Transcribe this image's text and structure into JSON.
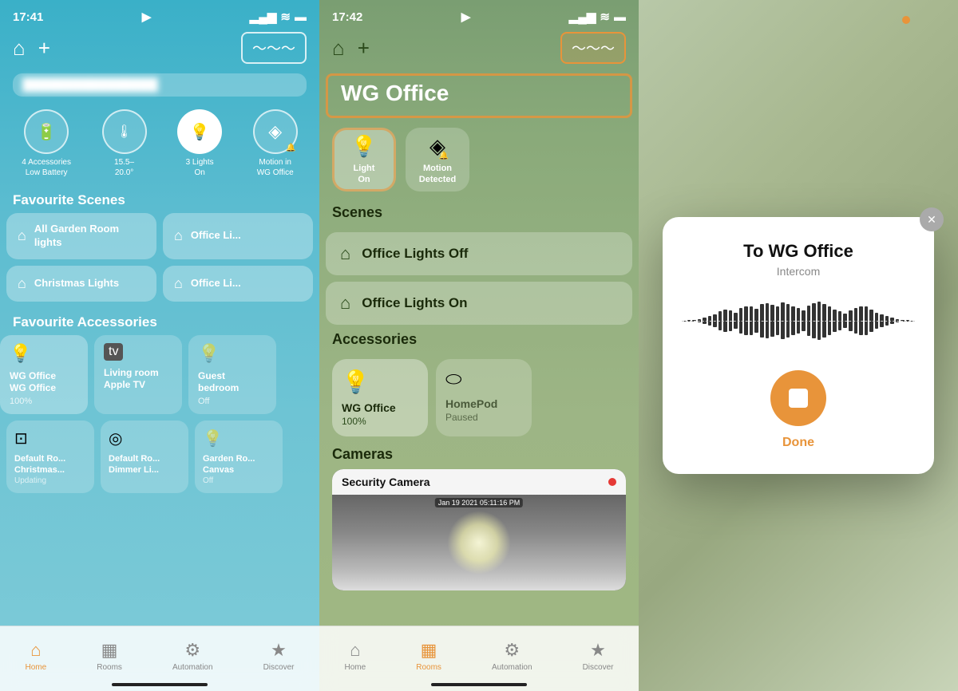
{
  "panel1": {
    "statusBar": {
      "time": "17:41",
      "locationIcon": "▶",
      "signal": "▂▄",
      "wifi": "📶",
      "battery": "🔋"
    },
    "nav": {
      "homeIcon": "⌂",
      "addIcon": "+",
      "soundwaveLabel": "〜〜〜"
    },
    "homeName": "Blurred Home Name",
    "accessories": [
      {
        "icon": "🔋",
        "label": "4 Accessories\nLow Battery",
        "active": false
      },
      {
        "icon": "🌡",
        "label": "15.5–\n20.0°",
        "active": false
      },
      {
        "icon": "💡",
        "label": "3 Lights\nOn",
        "active": true
      },
      {
        "icon": "◈",
        "label": "Motion in\nWG Office",
        "active": false
      }
    ],
    "favouriteScenes": {
      "heading": "Favourite Scenes",
      "items": [
        {
          "icon": "⌂",
          "label": "All Garden Room lights"
        },
        {
          "icon": "⌂",
          "label": "Office Li..."
        },
        {
          "icon": "⌂",
          "label": "Christmas Lights"
        },
        {
          "icon": "⌂",
          "label": "Office Li..."
        }
      ]
    },
    "favouriteAccessories": {
      "heading": "Favourite Accessories",
      "row1": [
        {
          "icon": "💡",
          "name": "WG Office\nWG Office",
          "status": "100%",
          "active": true
        },
        {
          "icon": "📺",
          "name": "Living room\nApple TV",
          "status": "",
          "active": false
        },
        {
          "icon": "💡",
          "name": "Guest\nbedroom",
          "status": "Off",
          "active": false
        }
      ],
      "row2": [
        {
          "icon": "⊡",
          "name": "Default Ro...\nChristmas...",
          "status": "Updating",
          "active": false
        },
        {
          "icon": "◎",
          "name": "Default Ro...\nDimmer Li...",
          "status": "",
          "active": false
        },
        {
          "icon": "💡",
          "name": "Garden Ro...\nCanvas",
          "status": "Off",
          "active": false
        }
      ]
    },
    "tabBar": {
      "tabs": [
        {
          "icon": "⌂",
          "label": "Home",
          "active": true
        },
        {
          "icon": "▦",
          "label": "Rooms",
          "active": false
        },
        {
          "icon": "⚙",
          "label": "Automation",
          "active": false
        },
        {
          "icon": "★",
          "label": "Discover",
          "active": false
        }
      ]
    }
  },
  "panel2": {
    "statusBar": {
      "time": "17:42",
      "locationIcon": "▶"
    },
    "nav": {
      "homeIcon": "⌂",
      "addIcon": "+",
      "soundwaveLabel": "〜〜〜"
    },
    "title": "WG Office",
    "accessories": [
      {
        "icon": "💡",
        "labelLine1": "Light",
        "labelLine2": "On"
      },
      {
        "icon": "◈",
        "labelLine1": "Motion",
        "labelLine2": "Detected"
      }
    ],
    "scenes": {
      "heading": "Scenes",
      "items": [
        {
          "icon": "⌂",
          "label": "Office Lights Off"
        },
        {
          "icon": "⌂",
          "label": "Office Lights On"
        }
      ]
    },
    "accessoriesSection": {
      "heading": "Accessories",
      "items": [
        {
          "icon": "💡",
          "name": "WG Office",
          "status": "100%",
          "muted": false
        },
        {
          "icon": "🔊",
          "name": "HomePod",
          "status": "Paused",
          "muted": true
        }
      ]
    },
    "cameras": {
      "heading": "Cameras",
      "cameraName": "Security Camera",
      "timestamp": "Jan 19 2021  05:11:16 PM"
    },
    "tabBar": {
      "tabs": [
        {
          "icon": "⌂",
          "label": "Home",
          "active": false
        },
        {
          "icon": "▦",
          "label": "Rooms",
          "active": true
        },
        {
          "icon": "⚙",
          "label": "Automation",
          "active": false
        },
        {
          "icon": "★",
          "label": "Discover",
          "active": false
        }
      ]
    }
  },
  "panel3": {
    "modal": {
      "title": "To WG Office",
      "subtitle": "Intercom",
      "stopButtonLabel": "Done",
      "closeIcon": "✕"
    },
    "waveformBars": [
      1,
      2,
      3,
      5,
      8,
      12,
      18,
      25,
      30,
      28,
      22,
      35,
      40,
      38,
      32,
      45,
      48,
      44,
      38,
      50,
      46,
      40,
      35,
      28,
      42,
      48,
      52,
      45,
      38,
      30,
      25,
      20,
      28,
      35,
      40,
      38,
      30,
      22,
      18,
      12,
      8,
      5,
      3,
      2,
      1
    ]
  }
}
